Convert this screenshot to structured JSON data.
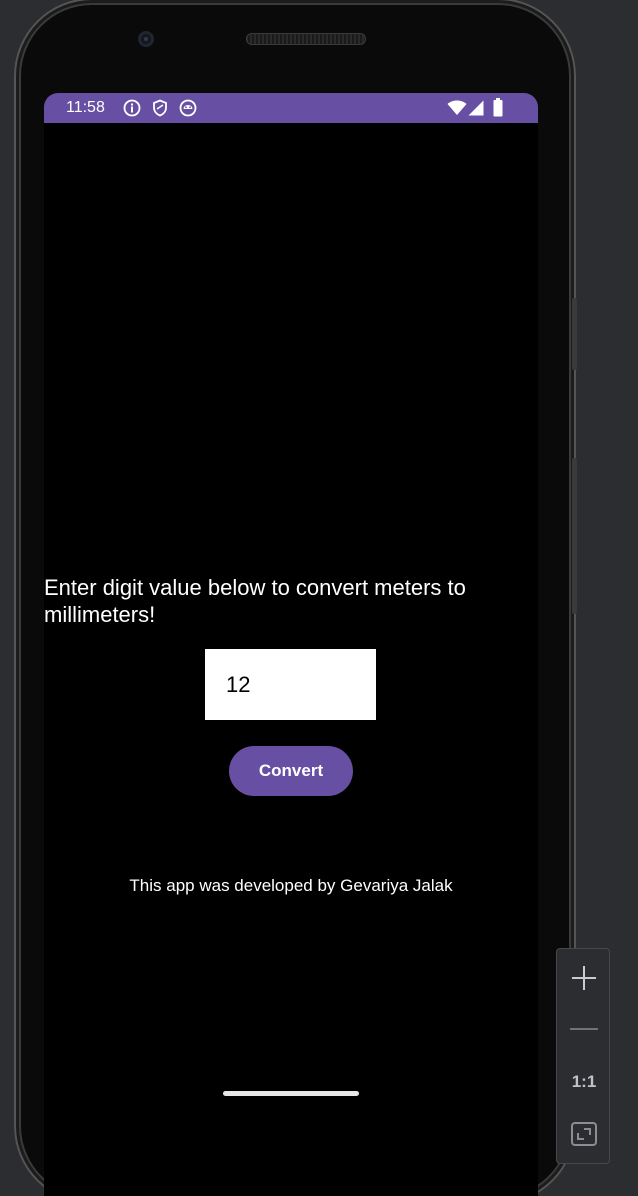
{
  "status_bar": {
    "time": "11:58",
    "color": "#6750a4",
    "left_icons": [
      "info-icon",
      "shield-icon",
      "android-icon"
    ],
    "right_icons": [
      "wifi-icon",
      "signal-icon",
      "battery-icon"
    ]
  },
  "main": {
    "prompt": "Enter digit value below to convert meters to millimeters!",
    "input_value": "12",
    "convert_label": "Convert",
    "credit": "This app was developed by Gevariya Jalak"
  },
  "zoom_toolbar": {
    "ratio_label": "1:1",
    "icons": [
      "zoom-in-icon",
      "zoom-out-icon",
      "fit-screen-icon"
    ]
  },
  "colors": {
    "accent": "#6750a4",
    "screen_background": "#000000",
    "window_background": "#2b2d30"
  }
}
